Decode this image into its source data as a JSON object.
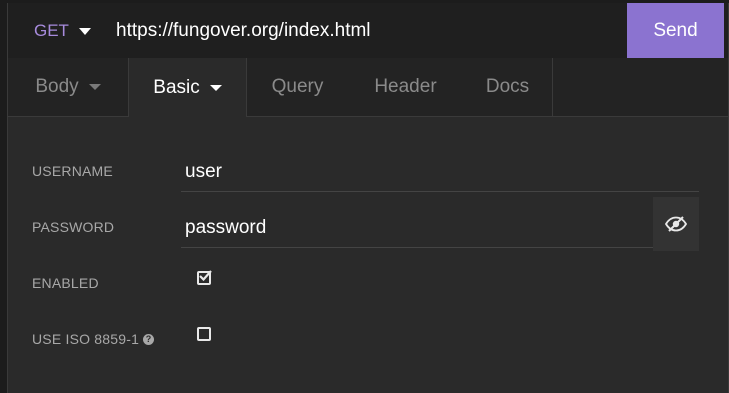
{
  "request": {
    "method": "GET",
    "url": "https://fungover.org/index.html",
    "send_label": "Send"
  },
  "tabs": [
    {
      "label": "Body",
      "has_dropdown": true,
      "active": false
    },
    {
      "label": "Basic",
      "has_dropdown": true,
      "active": true
    },
    {
      "label": "Query",
      "has_dropdown": false,
      "active": false
    },
    {
      "label": "Header",
      "has_dropdown": false,
      "active": false
    },
    {
      "label": "Docs",
      "has_dropdown": false,
      "active": false
    }
  ],
  "auth": {
    "username_label": "USERNAME",
    "username_value": "user",
    "password_label": "PASSWORD",
    "password_value": "password",
    "enabled_label": "ENABLED",
    "enabled_checked": true,
    "iso_label": "USE ISO 8859-1",
    "iso_checked": false
  },
  "icons": {
    "method_dropdown": "caret-down-icon",
    "visibility": "eye-slash-icon",
    "help": "question-circle-icon"
  },
  "colors": {
    "accent": "#8b73d0",
    "method": "#a78bdc"
  }
}
